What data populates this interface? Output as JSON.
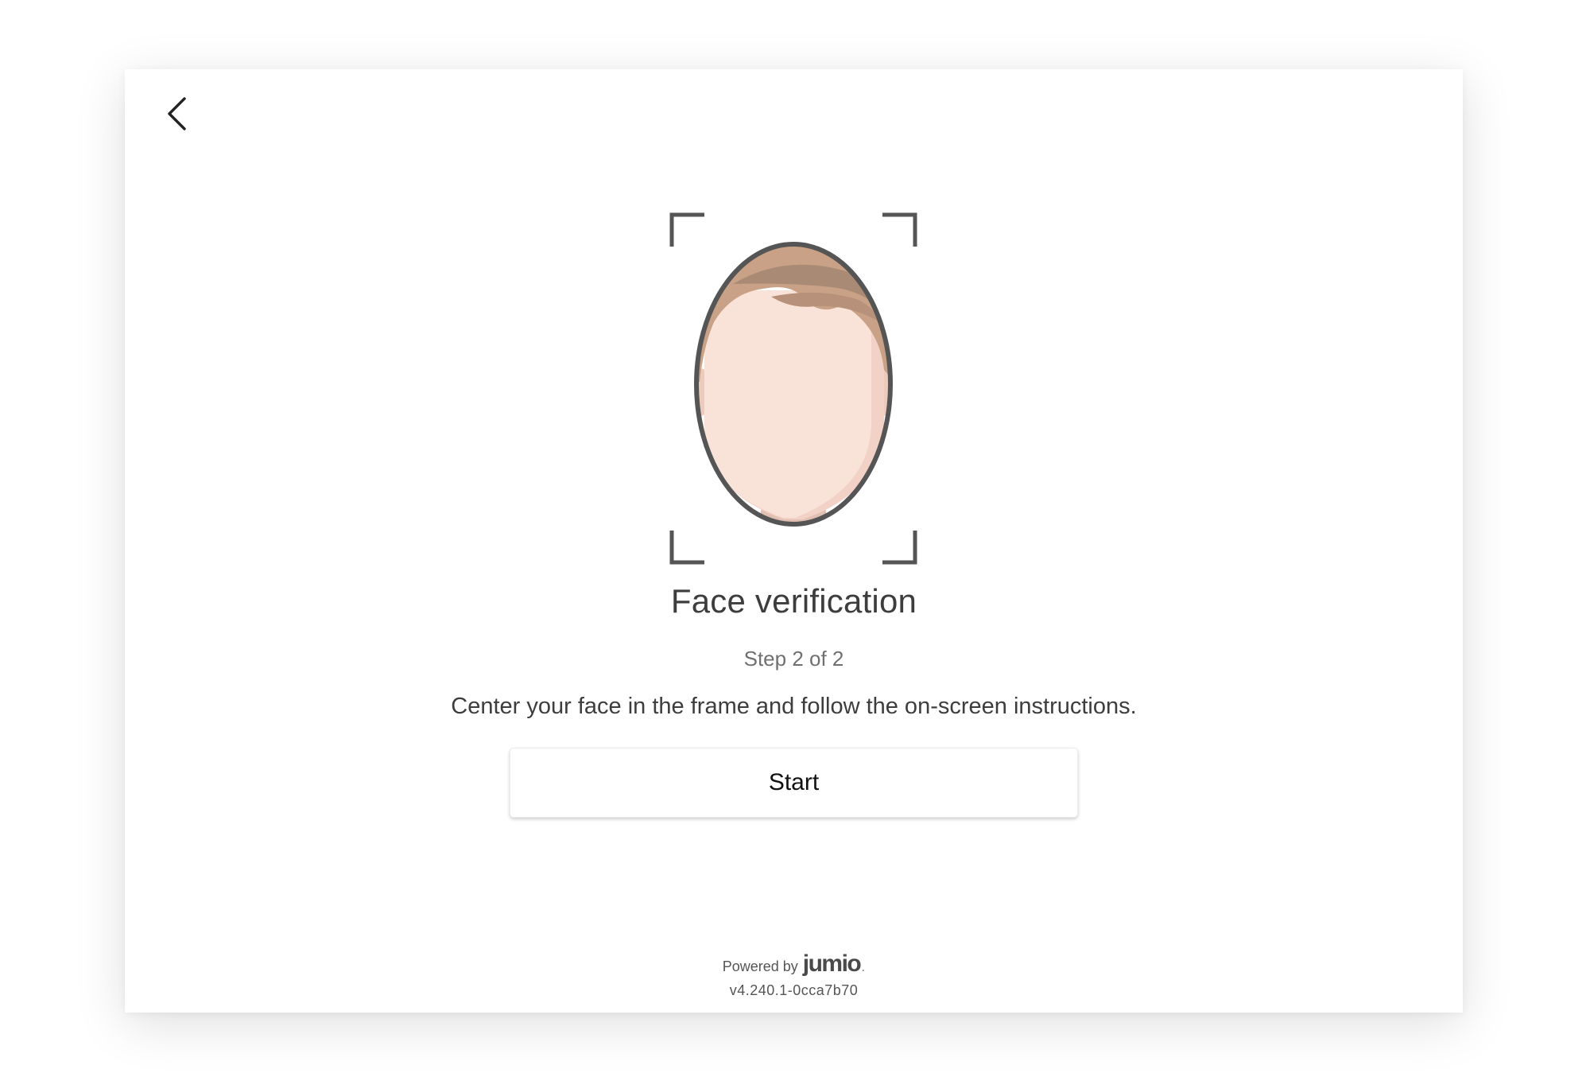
{
  "header": {
    "back_icon": "chevron-left-icon"
  },
  "illustration": {
    "icon": "face-scan-frame-icon",
    "colors": {
      "frame": "#555555",
      "hair": "#c8a186",
      "hair_dark": "#a98a74",
      "skin": "#f9e3d9",
      "skin_shadow": "#f2d2c7",
      "ear": "#eccbbd",
      "neck": "#e2bfb3"
    }
  },
  "main": {
    "title": "Face verification",
    "step_label": "Step 2 of 2",
    "instructions": "Center your face in the frame and follow the on-screen instructions.",
    "start_button_label": "Start"
  },
  "footer": {
    "powered_by": "Powered by",
    "brand": "jumio",
    "brand_dot": ".",
    "version": "v4.240.1-0cca7b70"
  },
  "colors": {
    "title": "#3d3d3d",
    "subtitle": "#707070",
    "button_text": "#111111",
    "card_background": "#ffffff"
  }
}
